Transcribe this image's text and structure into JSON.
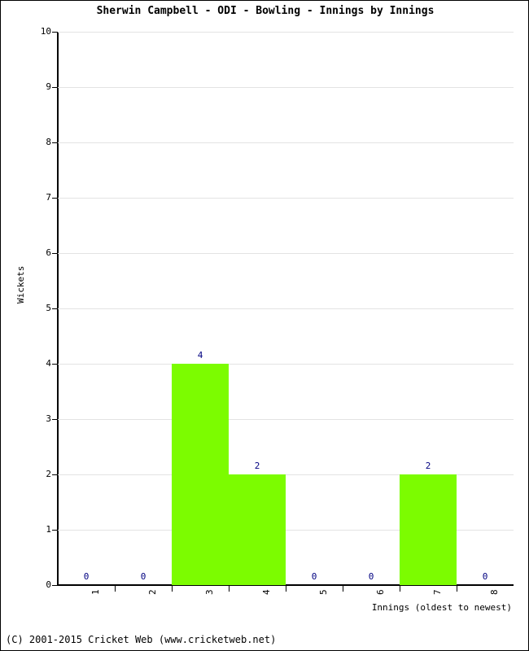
{
  "chart_data": {
    "type": "bar",
    "title": "Sherwin Campbell - ODI - Bowling - Innings by Innings",
    "xlabel": "Innings (oldest to newest)",
    "ylabel": "Wickets",
    "categories": [
      "1",
      "2",
      "3",
      "4",
      "5",
      "6",
      "7",
      "8"
    ],
    "values": [
      0,
      0,
      4,
      2,
      0,
      0,
      2,
      0
    ],
    "value_labels": [
      "0",
      "0",
      "4",
      "2",
      "0",
      "0",
      "2",
      "0"
    ],
    "ylim": [
      0,
      10
    ],
    "ytick_labels": [
      "0",
      "1",
      "2",
      "3",
      "4",
      "5",
      "6",
      "7",
      "8",
      "9",
      "10"
    ],
    "grid": true,
    "legend": false,
    "bar_color": "#7CFC00",
    "value_label_color": "#000080",
    "gridline_color": "#E3E3E3",
    "axis_color": "#000000"
  },
  "footer": {
    "copyright": "(C) 2001-2015 Cricket Web (www.cricketweb.net)"
  }
}
